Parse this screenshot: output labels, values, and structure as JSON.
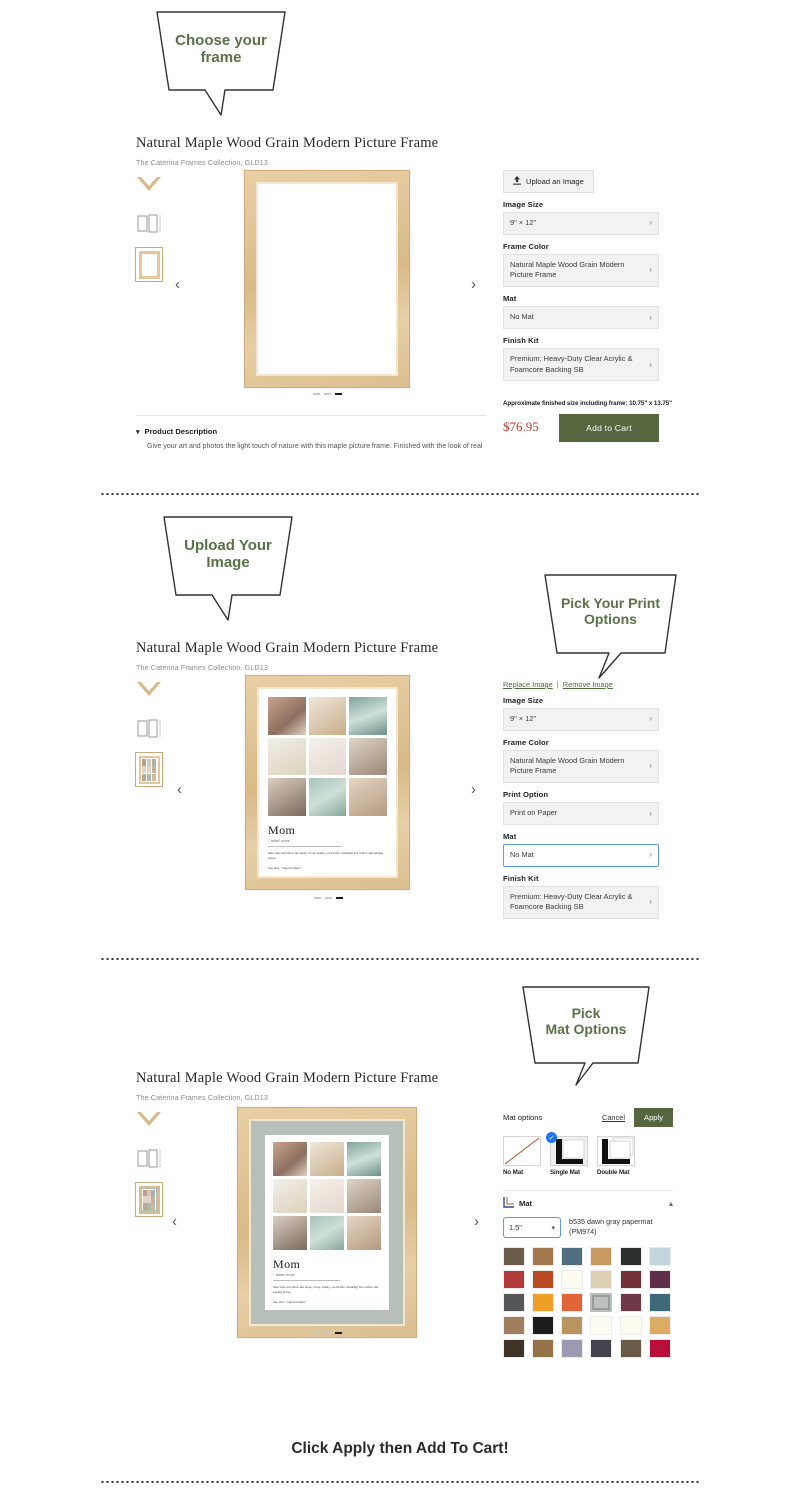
{
  "bubbles": {
    "choose_frame": "Choose your\nframe",
    "upload_image": "Upload Your\nImage",
    "print_options": "Pick Your Print\nOptions",
    "mat_options": "Pick\nMat Options"
  },
  "product": {
    "title": "Natural Maple Wood Grain Modern Picture Frame",
    "subtitle": "The Caterina Frames Collection, GLD13"
  },
  "art": {
    "title": "Mom",
    "pronunciation": "/ˈmäm/ noun",
    "definition": "One who sacrifices her sleep, body, sanity, social life, drinking hot coffee and peeing alone.",
    "see_also": "See also: \"superwoman\""
  },
  "step1": {
    "upload_button": "Upload an Image",
    "upload_icon": "upload-icon",
    "options": [
      {
        "label": "Image Size",
        "value": "9\" × 12\""
      },
      {
        "label": "Frame Color",
        "value": "Natural Maple Wood Grain Modern Picture Frame"
      },
      {
        "label": "Mat",
        "value": "No Mat"
      },
      {
        "label": "Finish Kit",
        "value": "Premium: Heavy-Duty Clear Acrylic & Foamcore Backing SB"
      }
    ],
    "finished_size_note": "Approximate finished size including frame: 10.75\" x 13.75\"",
    "price": "$76.95",
    "add_to_cart": "Add to Cart",
    "description_heading": "Product Description",
    "description_body": "Give your art and photos the light touch of nature with this maple picture frame. Finished with the look of real"
  },
  "step2": {
    "replace_link": "Replace Image",
    "remove_link": "Remove Image",
    "link_divider": "|",
    "options": [
      {
        "label": "Image Size",
        "value": "9\" × 12\"",
        "focused": false
      },
      {
        "label": "Frame Color",
        "value": "Natural Maple Wood Grain Modern Picture Frame",
        "focused": false
      },
      {
        "label": "Print Option",
        "value": "Print on Paper",
        "focused": false
      },
      {
        "label": "Mat",
        "value": "No Mat",
        "focused": true
      },
      {
        "label": "Finish Kit",
        "value": "Premium: Heavy-Duty Clear Acrylic & Foamcore Backing SB",
        "focused": false
      }
    ]
  },
  "step3": {
    "panel_title": "Mat options",
    "cancel": "Cancel",
    "apply": "Apply",
    "mat_types": [
      {
        "label": "No Mat",
        "selected": false
      },
      {
        "label": "Single Mat",
        "selected": true
      },
      {
        "label": "Double Mat",
        "selected": false
      }
    ],
    "mat_section_label": "Mat",
    "mat_size": "1.5\"",
    "selected_swatch_name": "b535 dawn gray papermat (PM974)",
    "collapse_icon": "chevron-up-icon",
    "swatches": [
      "#6b5c4a",
      "#a4794f",
      "#4e6d7f",
      "#c79a62",
      "#2b2f30",
      "#c3d5dd",
      "#b23b3b",
      "#b84a23",
      "#fdfdf2",
      "#ded0b5",
      "#733036",
      "#60304a",
      "#53575a",
      "#eda028",
      "#e2653a",
      "#b9c2bb",
      "#6e3a45",
      "#3f6878",
      "#a07e5e",
      "#1d1d1d",
      "#b89460",
      "#fdfdf4",
      "#fdfcef",
      "#ddab62",
      "#3e3326",
      "#94724a",
      "#9a9ab0",
      "#44424a",
      "#6b5a45",
      "#b80f3a"
    ],
    "selected_swatch_index": 15
  },
  "nav": {
    "prev_icon": "chevron-left-icon",
    "next_icon": "chevron-right-icon",
    "dot_count": 3,
    "active_dot": 2
  },
  "thumbnails": [
    {
      "name": "frame-corner-thumbnail"
    },
    {
      "name": "frame-dimensions-thumbnail"
    },
    {
      "name": "frame-front-thumbnail"
    }
  ],
  "footer": {
    "cta": "Click Apply then Add To Cart!"
  },
  "colors": {
    "accent_green": "#56663f",
    "bubble_text": "#5a7247",
    "price_red": "#c0392b",
    "focus_blue": "#5b9ae8",
    "mat_gray": "#b6bfb8"
  }
}
